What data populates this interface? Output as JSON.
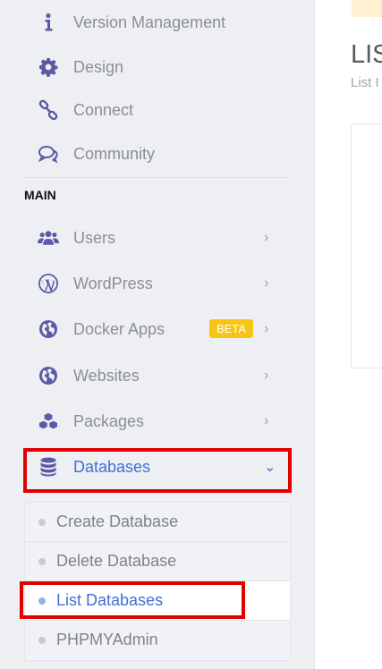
{
  "sidebar": {
    "top_items": [
      {
        "label": "Version Management",
        "icon": "info-icon"
      },
      {
        "label": "Design",
        "icon": "gear-icon"
      },
      {
        "label": "Connect",
        "icon": "link-icon"
      },
      {
        "label": "Community",
        "icon": "chat-icon"
      }
    ],
    "section_main": "MAIN",
    "main_items": [
      {
        "label": "Users",
        "icon": "users-icon",
        "chevron": "›"
      },
      {
        "label": "WordPress",
        "icon": "wordpress-icon",
        "chevron": "›"
      },
      {
        "label": "Docker Apps",
        "icon": "globe-icon",
        "chevron": "›",
        "badge": "BETA"
      },
      {
        "label": "Websites",
        "icon": "globe-icon",
        "chevron": "›"
      },
      {
        "label": "Packages",
        "icon": "cubes-icon",
        "chevron": "›"
      },
      {
        "label": "Databases",
        "icon": "database-icon",
        "chevron": "⌄"
      }
    ],
    "databases_submenu": [
      {
        "label": "Create Database"
      },
      {
        "label": "Delete Database"
      },
      {
        "label": "List Databases"
      },
      {
        "label": "PHPMYAdmin"
      }
    ]
  },
  "content": {
    "title": "LIS",
    "subtitle": "List I"
  },
  "colors": {
    "icon": "#5b5aa6",
    "active": "#3f6fd6",
    "highlight_border": "#e00000",
    "beta": "#f5c518"
  }
}
